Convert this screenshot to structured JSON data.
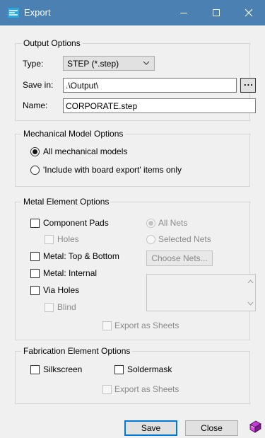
{
  "window": {
    "title": "Export",
    "icon": "export-icon"
  },
  "output_options": {
    "title": "Output Options",
    "type_label": "Type:",
    "type_value": "STEP (*.step)",
    "save_in_label": "Save in:",
    "save_in_value": ".\\Output\\",
    "browse_label": "...",
    "name_label": "Name:",
    "name_value": "CORPORATE.step"
  },
  "mechanical": {
    "title": "Mechanical Model Options",
    "all_models": "All mechanical models",
    "include_only": "'Include with board export' items only",
    "selected": "all_models"
  },
  "metal": {
    "title": "Metal Element Options",
    "component_pads": "Component Pads",
    "holes": "Holes",
    "top_bottom": "Metal: Top & Bottom",
    "internal": "Metal: Internal",
    "via_holes": "Via Holes",
    "blind": "Blind",
    "all_nets": "All Nets",
    "selected_nets": "Selected Nets",
    "choose_nets": "Choose Nets...",
    "export_sheets": "Export as Sheets"
  },
  "fabrication": {
    "title": "Fabrication Element Options",
    "silkscreen": "Silkscreen",
    "soldermask": "Soldermask",
    "export_sheets": "Export as Sheets"
  },
  "footer": {
    "save": "Save",
    "close": "Close"
  },
  "colors": {
    "titlebar": "#4a80b2",
    "accent": "#0078d7",
    "background": "#f0f0f0"
  }
}
